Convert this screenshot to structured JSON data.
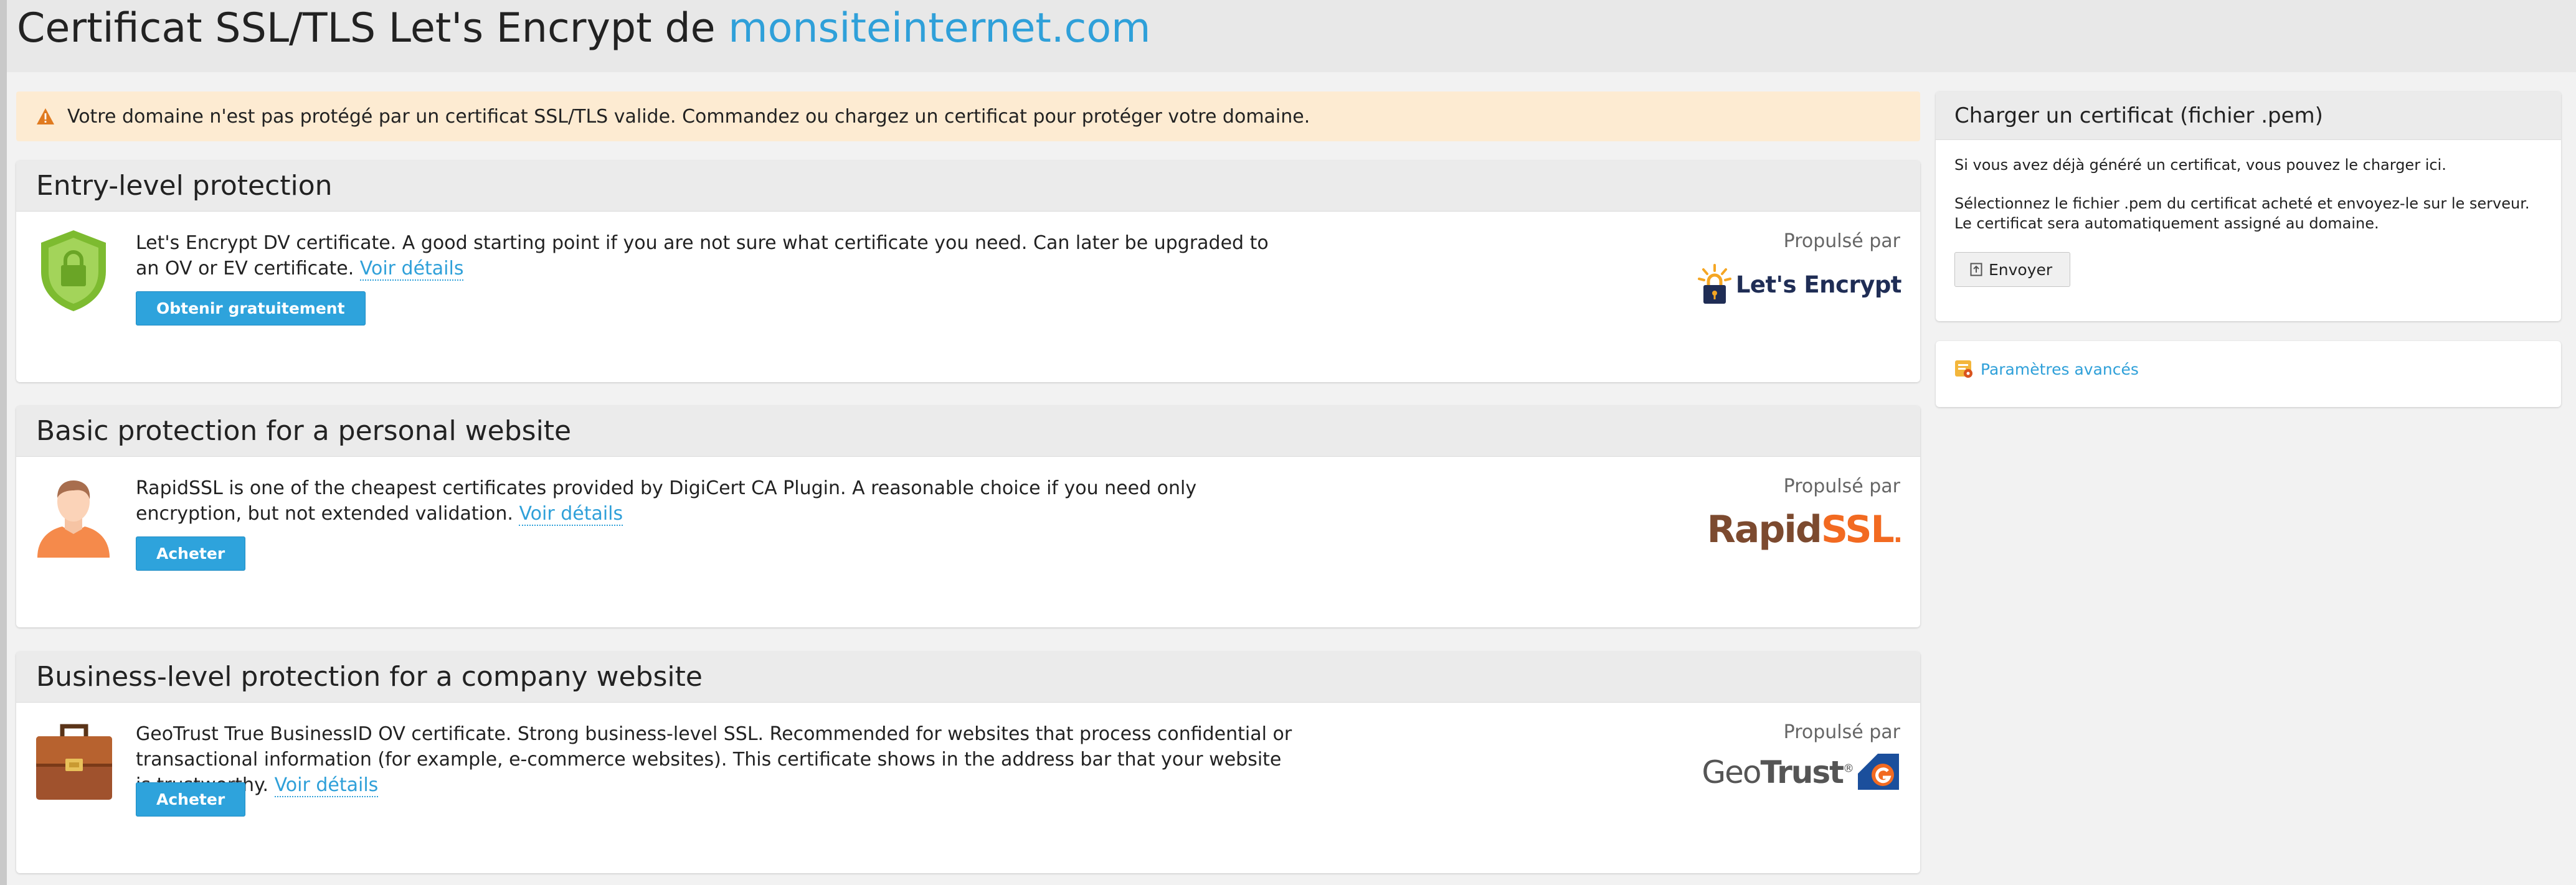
{
  "header": {
    "title_prefix": "Certificat SSL/TLS Let's Encrypt de",
    "domain": "monsiteinternet.com"
  },
  "warning": {
    "icon": "warning-triangle-icon",
    "text": "Votre domaine n'est pas protégé par un certificat SSL/TLS valide. Commandez ou chargez un certificat pour protéger votre domaine."
  },
  "offers": [
    {
      "title": "Entry-level protection",
      "icon": "shield-lock-icon",
      "description": "Let's Encrypt DV certificate. A good starting point if you are not sure what certificate you need. Can later be upgraded to an OV or EV certificate.",
      "details_link": "Voir détails",
      "button": "Obtenir gratuitement",
      "powered_by": "Propulsé par",
      "brand": "Let's Encrypt"
    },
    {
      "title": "Basic protection for a personal website",
      "icon": "person-icon",
      "description": "RapidSSL is one of the cheapest certificates provided by DigiCert CA Plugin. A reasonable choice if you need only encryption, but not extended validation.",
      "details_link": "Voir détails",
      "button": "Acheter",
      "powered_by": "Propulsé par",
      "brand_a": "Rapid",
      "brand_b": "SSL"
    },
    {
      "title": "Business-level protection for a company website",
      "icon": "briefcase-icon",
      "description": "GeoTrust True BusinessID OV certificate. Strong business-level SSL. Recommended for websites that process confidential or transactional information (for example, e-commerce websites). This certificate shows in the address bar that your website is trustworthy.",
      "details_link": "Voir détails",
      "button": "Acheter",
      "powered_by": "Propulsé par",
      "brand_a": "Geo",
      "brand_b": "Trust"
    }
  ],
  "upload": {
    "title": "Charger un certificat (fichier .pem)",
    "text1": "Si vous avez déjà généré un certificat, vous pouvez le charger ici.",
    "text2": "Sélectionnez le fichier .pem du certificat acheté et envoyez-le sur le serveur. Le certificat sera automatiquement assigné au domaine.",
    "button": "Envoyer"
  },
  "advanced": {
    "link": "Paramètres avancés"
  },
  "colors": {
    "accent": "#2fa0d9",
    "warning_bg": "#fdebd2",
    "warning_icon": "#e07a1f",
    "letsencrypt_navy": "#1f2d55",
    "letsencrypt_gold": "#f5a623",
    "rapidssl_brown": "#7c4a2f",
    "rapidssl_orange": "#f26a21",
    "geotrust_gray": "#555555",
    "geotrust_blue": "#1b4f9c"
  }
}
